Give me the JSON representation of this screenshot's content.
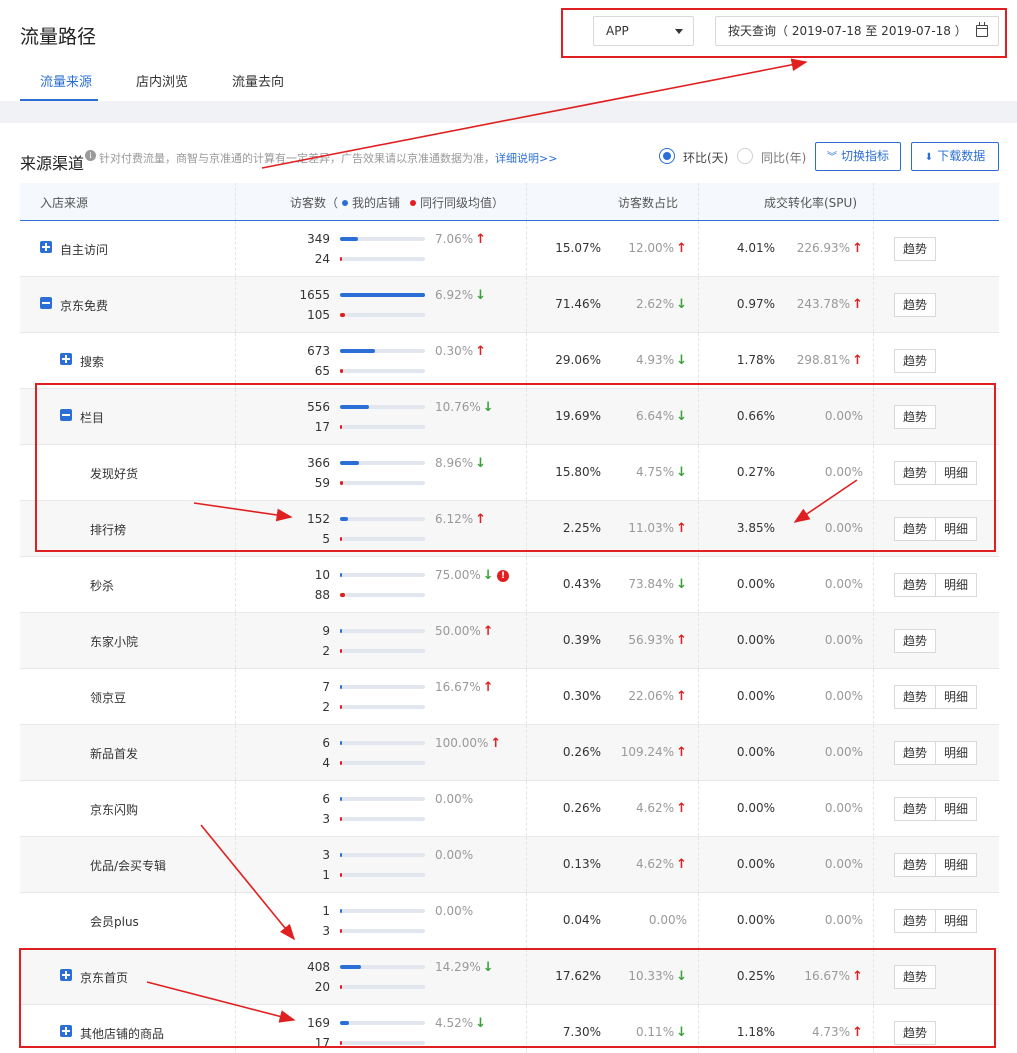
{
  "header": {
    "title": "流量路径",
    "tabs": [
      {
        "label": "流量来源",
        "active": true
      },
      {
        "label": "店内浏览",
        "active": false
      },
      {
        "label": "流量去向",
        "active": false
      }
    ],
    "platform_select": "APP",
    "date_query": "按天查询（ 2019-07-18 至 2019-07-18 ）"
  },
  "section": {
    "title": "来源渠道",
    "note": "针对付费流量，商智与京准通的计算有一定差异，广告效果请以京准通数据为准，",
    "link": "详细说明>>",
    "radio_mom": "环比(天)",
    "radio_yoy": "同比(年)",
    "switch_button": "切换指标",
    "download_button": "下载数据"
  },
  "table": {
    "col_source": "入店来源",
    "col_visitors": "访客数（",
    "legend_mine": "我的店铺",
    "legend_peer": "同行同级均值",
    "legend_close": "）",
    "col_share": "访客数占比",
    "col_conversion": "成交转化率(SPU)",
    "btn_trend": "趋势",
    "btn_detail": "明细",
    "max_visitors": 1655,
    "rows": [
      {
        "name": "自主访问",
        "level": 0,
        "expander": "plus",
        "v_mine": 349,
        "v_peer": 24,
        "v_change": "7.06%",
        "v_dir": "up",
        "share": "15.07%",
        "share_change": "12.00%",
        "share_dir": "up",
        "conv": "4.01%",
        "conv_change": "226.93%",
        "conv_dir": "up",
        "detail": false
      },
      {
        "name": "京东免费",
        "level": 0,
        "expander": "minus",
        "v_mine": 1655,
        "v_peer": 105,
        "v_change": "6.92%",
        "v_dir": "down",
        "share": "71.46%",
        "share_change": "2.62%",
        "share_dir": "down",
        "conv": "0.97%",
        "conv_change": "243.78%",
        "conv_dir": "up",
        "detail": false
      },
      {
        "name": "搜索",
        "level": 1,
        "expander": "plus",
        "v_mine": 673,
        "v_peer": 65,
        "v_change": "0.30%",
        "v_dir": "up",
        "share": "29.06%",
        "share_change": "4.93%",
        "share_dir": "down",
        "conv": "1.78%",
        "conv_change": "298.81%",
        "conv_dir": "up",
        "detail": false
      },
      {
        "name": "栏目",
        "level": 1,
        "expander": "minus",
        "v_mine": 556,
        "v_peer": 17,
        "v_change": "10.76%",
        "v_dir": "down",
        "share": "19.69%",
        "share_change": "6.64%",
        "share_dir": "down",
        "conv": "0.66%",
        "conv_change": "0.00%",
        "conv_dir": "",
        "detail": false
      },
      {
        "name": "发现好货",
        "level": 2,
        "expander": "",
        "v_mine": 366,
        "v_peer": 59,
        "v_change": "8.96%",
        "v_dir": "down",
        "share": "15.80%",
        "share_change": "4.75%",
        "share_dir": "down",
        "conv": "0.27%",
        "conv_change": "0.00%",
        "conv_dir": "",
        "detail": true
      },
      {
        "name": "排行榜",
        "level": 2,
        "expander": "",
        "v_mine": 152,
        "v_peer": 5,
        "v_change": "6.12%",
        "v_dir": "up",
        "share": "2.25%",
        "share_change": "11.03%",
        "share_dir": "up",
        "conv": "3.85%",
        "conv_change": "0.00%",
        "conv_dir": "",
        "detail": true
      },
      {
        "name": "秒杀",
        "level": 2,
        "expander": "",
        "v_mine": 10,
        "v_peer": 88,
        "v_change": "75.00%",
        "v_dir": "down",
        "warn": true,
        "share": "0.43%",
        "share_change": "73.84%",
        "share_dir": "down",
        "conv": "0.00%",
        "conv_change": "0.00%",
        "conv_dir": "",
        "detail": true
      },
      {
        "name": "东家小院",
        "level": 2,
        "expander": "",
        "v_mine": 9,
        "v_peer": 2,
        "v_change": "50.00%",
        "v_dir": "up",
        "share": "0.39%",
        "share_change": "56.93%",
        "share_dir": "up",
        "conv": "0.00%",
        "conv_change": "0.00%",
        "conv_dir": "",
        "detail": false
      },
      {
        "name": "领京豆",
        "level": 2,
        "expander": "",
        "v_mine": 7,
        "v_peer": 2,
        "v_change": "16.67%",
        "v_dir": "up",
        "share": "0.30%",
        "share_change": "22.06%",
        "share_dir": "up",
        "conv": "0.00%",
        "conv_change": "0.00%",
        "conv_dir": "",
        "detail": true
      },
      {
        "name": "新品首发",
        "level": 2,
        "expander": "",
        "v_mine": 6,
        "v_peer": 4,
        "v_change": "100.00%",
        "v_dir": "up",
        "share": "0.26%",
        "share_change": "109.24%",
        "share_dir": "up",
        "conv": "0.00%",
        "conv_change": "0.00%",
        "conv_dir": "",
        "detail": true
      },
      {
        "name": "京东闪购",
        "level": 2,
        "expander": "",
        "v_mine": 6,
        "v_peer": 3,
        "v_change": "0.00%",
        "v_dir": "",
        "share": "0.26%",
        "share_change": "4.62%",
        "share_dir": "up",
        "conv": "0.00%",
        "conv_change": "0.00%",
        "conv_dir": "",
        "detail": true
      },
      {
        "name": "优品/会买专辑",
        "level": 2,
        "expander": "",
        "v_mine": 3,
        "v_peer": 1,
        "v_change": "0.00%",
        "v_dir": "",
        "share": "0.13%",
        "share_change": "4.62%",
        "share_dir": "up",
        "conv": "0.00%",
        "conv_change": "0.00%",
        "conv_dir": "",
        "detail": true
      },
      {
        "name": "会员plus",
        "level": 2,
        "expander": "",
        "v_mine": 1,
        "v_peer": 3,
        "v_change": "0.00%",
        "v_dir": "",
        "share": "0.04%",
        "share_change": "0.00%",
        "share_dir": "",
        "conv": "0.00%",
        "conv_change": "0.00%",
        "conv_dir": "",
        "detail": true
      },
      {
        "name": "京东首页",
        "level": 1,
        "expander": "plus",
        "v_mine": 408,
        "v_peer": 20,
        "v_change": "14.29%",
        "v_dir": "down",
        "share": "17.62%",
        "share_change": "10.33%",
        "share_dir": "down",
        "conv": "0.25%",
        "conv_change": "16.67%",
        "conv_dir": "up",
        "detail": false
      },
      {
        "name": "其他店铺的商品",
        "level": 1,
        "expander": "plus",
        "v_mine": 169,
        "v_peer": 17,
        "v_change": "4.52%",
        "v_dir": "down",
        "share": "7.30%",
        "share_change": "0.11%",
        "share_dir": "down",
        "conv": "1.18%",
        "conv_change": "4.73%",
        "conv_dir": "up",
        "detail": false
      }
    ]
  },
  "colors": {
    "accent": "#2b6fd6",
    "up": "#e02020",
    "down": "#3aa13a",
    "annotation": "#e02020"
  }
}
